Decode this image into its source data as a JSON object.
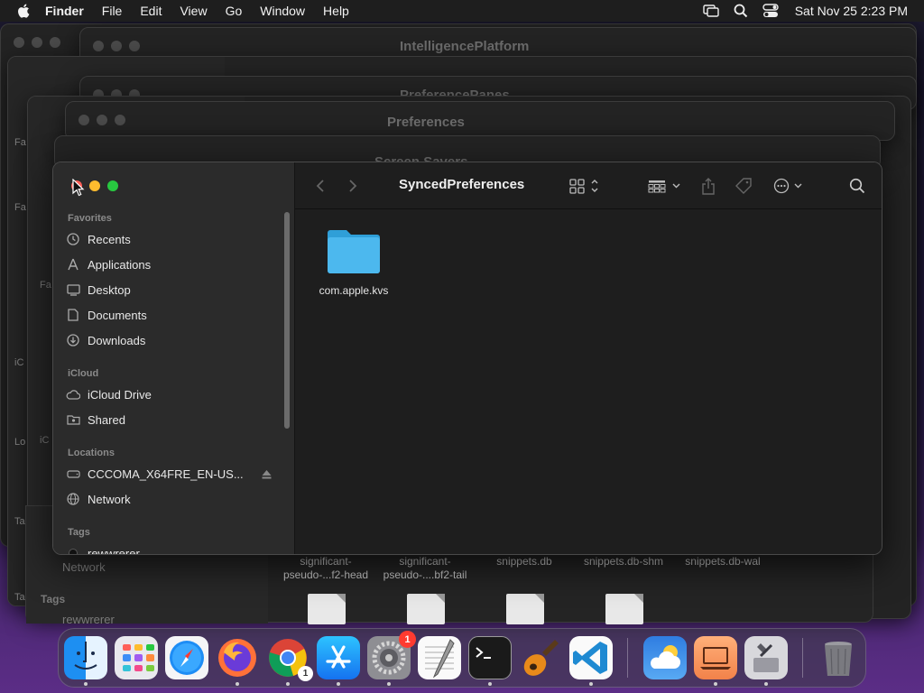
{
  "menubar": {
    "app_name": "Finder",
    "items": [
      "File",
      "Edit",
      "View",
      "Go",
      "Window",
      "Help"
    ],
    "clock": "Sat Nov 25  2:23 PM"
  },
  "background_windows": [
    {
      "title": "IntelligencePlatform"
    },
    {
      "title": "PreferencePanes"
    },
    {
      "title": "Preferences"
    },
    {
      "title": "Screen Savers"
    }
  ],
  "background_sidebar": {
    "labels": [
      "Fa",
      "Fa",
      "Fa",
      "iC",
      "iC",
      "Lo",
      "Lo",
      "Ta",
      "Ta"
    ],
    "network": "Network",
    "tags": "Tags",
    "tag_item": "rewwrerer"
  },
  "background_files": [
    {
      "line1": "significant-",
      "line2": "pseudo-...f2-head"
    },
    {
      "line1": "significant-",
      "line2": "pseudo-....bf2-tail"
    },
    {
      "line1": "snippets.db",
      "line2": ""
    },
    {
      "line1": "snippets.db-shm",
      "line2": ""
    },
    {
      "line1": "snippets.db-wal",
      "line2": ""
    }
  ],
  "finder": {
    "title": "SyncedPreferences",
    "sidebar": {
      "favorites_header": "Favorites",
      "favorites": [
        {
          "label": "Recents",
          "icon": "clock-icon"
        },
        {
          "label": "Applications",
          "icon": "applications-icon"
        },
        {
          "label": "Desktop",
          "icon": "desktop-icon"
        },
        {
          "label": "Documents",
          "icon": "document-icon"
        },
        {
          "label": "Downloads",
          "icon": "download-icon"
        }
      ],
      "icloud_header": "iCloud",
      "icloud": [
        {
          "label": "iCloud Drive",
          "icon": "cloud-icon"
        },
        {
          "label": "Shared",
          "icon": "shared-folder-icon"
        }
      ],
      "locations_header": "Locations",
      "locations": [
        {
          "label": "CCCOMA_X64FRE_EN-US...",
          "icon": "drive-icon"
        },
        {
          "label": "Network",
          "icon": "network-icon"
        }
      ],
      "tags_header": "Tags",
      "tags": [
        {
          "label": "rewwrerer",
          "color": "#111111"
        }
      ]
    },
    "files": [
      {
        "name": "com.apple.kvs",
        "icon": "folder-icon",
        "color": "#3ab0e8"
      }
    ]
  },
  "dock": {
    "apps": [
      {
        "name": "Finder",
        "icon": "finder-icon"
      },
      {
        "name": "Launchpad",
        "icon": "launchpad-icon"
      },
      {
        "name": "Safari",
        "icon": "safari-icon"
      },
      {
        "name": "Firefox",
        "icon": "firefox-icon"
      },
      {
        "name": "Chrome",
        "icon": "chrome-icon",
        "badge": "1"
      },
      {
        "name": "App Store",
        "icon": "app-store-icon"
      },
      {
        "name": "System Settings",
        "icon": "settings-icon",
        "badge": "1"
      },
      {
        "name": "TextEdit",
        "icon": "textedit-icon"
      },
      {
        "name": "Terminal",
        "icon": "terminal-icon"
      },
      {
        "name": "GarageBand",
        "icon": "guitar-icon"
      },
      {
        "name": "VS Code",
        "icon": "vscode-icon"
      },
      {
        "name": "Weather",
        "icon": "weather-icon"
      },
      {
        "name": "Laptop",
        "icon": "laptop-icon"
      },
      {
        "name": "Disk Utility",
        "icon": "disk-icon"
      },
      {
        "name": "Trash",
        "icon": "trash-icon"
      }
    ]
  }
}
